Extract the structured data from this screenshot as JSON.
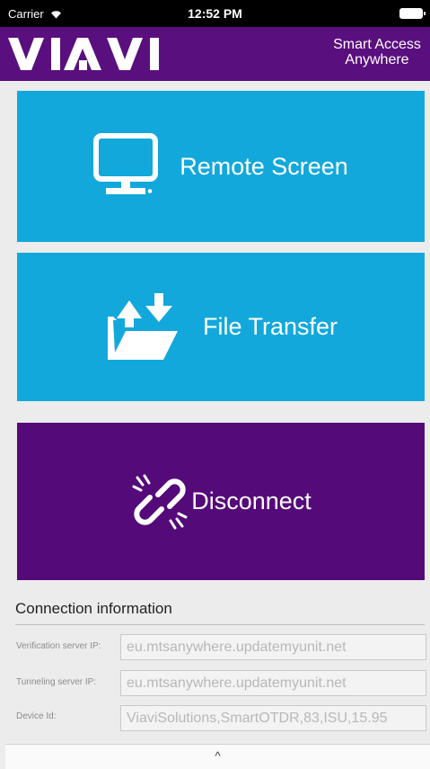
{
  "status_bar": {
    "carrier": "Carrier",
    "time": "12:52 PM",
    "icons": [
      "wifi-icon",
      "battery-icon"
    ]
  },
  "header": {
    "logo_text": "VIAVI",
    "tagline_line1": "Smart Access",
    "tagline_line2": "Anywhere",
    "background": "#5a0f7e"
  },
  "actions": {
    "remote_screen": {
      "label": "Remote Screen",
      "icon": "monitor-icon",
      "color": "#12a8dc"
    },
    "file_transfer": {
      "label": "File Transfer",
      "icon": "folder-transfer-icon",
      "color": "#12a8dc"
    },
    "disconnect": {
      "label": "Disconnect",
      "icon": "broken-link-icon",
      "color": "#550a79"
    }
  },
  "connection_info": {
    "title": "Connection information",
    "rows": [
      {
        "label": "Verification server IP:",
        "value": "eu.mtsanywhere.updatemyunit.net"
      },
      {
        "label": "Tunneling server IP:",
        "value": "eu.mtsanywhere.updatemyunit.net"
      },
      {
        "label": "Device Id:",
        "value": "ViaviSolutions,SmartOTDR,83,ISU,15.95"
      }
    ]
  },
  "footer": {
    "collapse_label": "^"
  }
}
